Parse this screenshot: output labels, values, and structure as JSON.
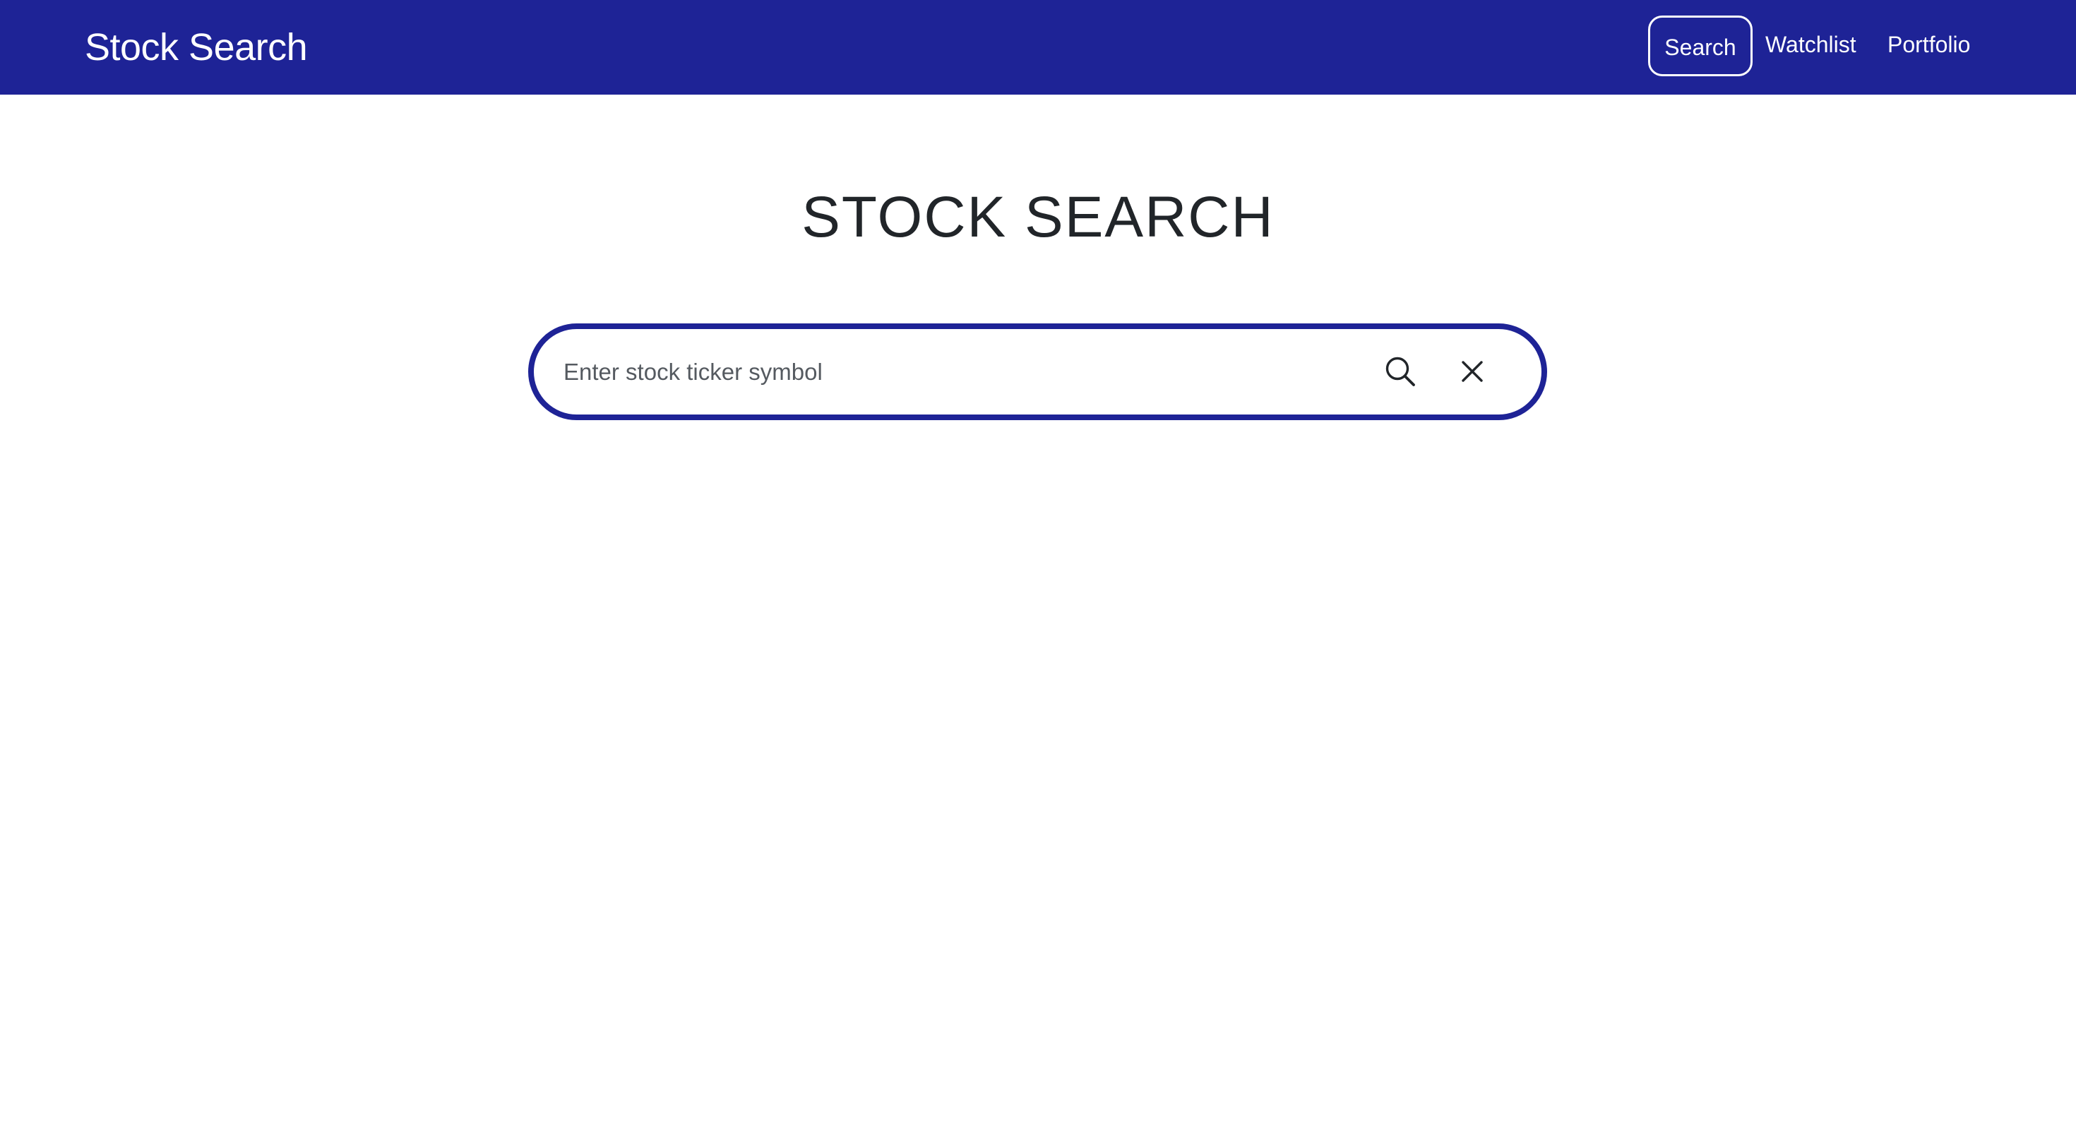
{
  "navbar": {
    "brand": "Stock Search",
    "items": [
      {
        "label": "Search",
        "active": true
      },
      {
        "label": "Watchlist",
        "active": false
      },
      {
        "label": "Portfolio",
        "active": false
      }
    ]
  },
  "main": {
    "title": "STOCK SEARCH",
    "search": {
      "placeholder": "Enter stock ticker symbol",
      "value": "",
      "search_icon": "search-icon",
      "clear_icon": "close-icon"
    }
  },
  "colors": {
    "navbar_bg": "#1e2396",
    "accent": "#1e2396",
    "text": "#212529",
    "background": "#ffffff"
  }
}
